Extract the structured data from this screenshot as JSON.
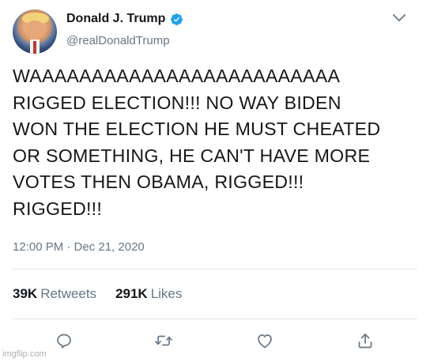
{
  "user": {
    "display_name": "Donald J. Trump",
    "handle": "@realDonaldTrump",
    "verified": true
  },
  "tweet": {
    "text": "WAAAAAAAAAAAAAAAAAAAAAAAAA\nRIGGED ELECTION!!! NO WAY BIDEN\nWON THE ELECTION HE MUST CHEATED\nOR SOMETHING, HE CAN'T HAVE MORE\nVOTES THEN OBAMA, RIGGED!!!\nRIGGED!!!",
    "timestamp": "12:00 PM · Dec 21, 2020"
  },
  "stats": {
    "retweets_count": "39K",
    "retweets_label": "Retweets",
    "likes_count": "291K",
    "likes_label": "Likes"
  },
  "actions": [
    {
      "name": "reply",
      "icon": "reply-icon"
    },
    {
      "name": "retweet",
      "icon": "retweet-icon"
    },
    {
      "name": "like",
      "icon": "heart-icon"
    },
    {
      "name": "share",
      "icon": "share-icon"
    }
  ],
  "colors": {
    "text": "#14171a",
    "secondary": "#657786",
    "verified": "#1da1f2",
    "divider": "#e1e8ed"
  },
  "watermark": "imgflip.com"
}
